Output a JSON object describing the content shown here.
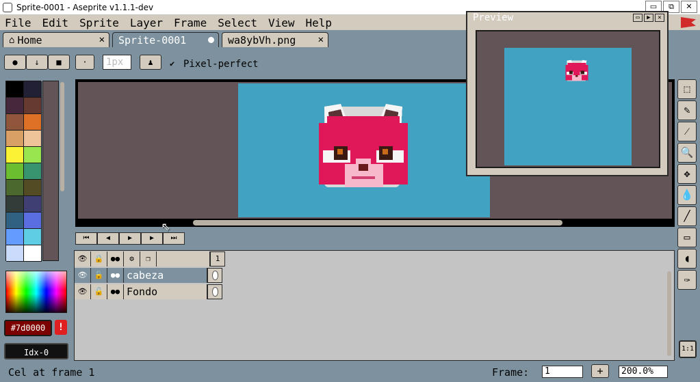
{
  "window": {
    "title": "Sprite-0001 - Aseprite v1.1.1-dev",
    "minimize": "▭",
    "restore": "⧉",
    "close": "✕"
  },
  "menu": [
    "File",
    "Edit",
    "Sprite",
    "Layer",
    "Frame",
    "Select",
    "View",
    "Help"
  ],
  "tabs": [
    {
      "label": "Home",
      "icon": "home-icon",
      "close": "✕"
    },
    {
      "label": "Sprite-0001",
      "active": true
    },
    {
      "label": "wa8ybVh.png",
      "close": "✕"
    }
  ],
  "toolbar": {
    "brush_size": "1px",
    "pixel_perfect_check": "✔",
    "pixel_perfect_label": "Pixel-perfect"
  },
  "palette": {
    "colors": [
      "#000000",
      "#222034",
      "#45283c",
      "#663931",
      "#8f563b",
      "#df7126",
      "#d9a066",
      "#eec39a",
      "#fbf236",
      "#99e550",
      "#6abe30",
      "#37946e",
      "#4b692f",
      "#524b24",
      "#323c39",
      "#3f3f74",
      "#306082",
      "#5b6ee1",
      "#639bff",
      "#5fcde4",
      "#cbdbfc",
      "#ffffff"
    ],
    "fg_hex": "#7d0000",
    "warning": "!",
    "index": "Idx-0"
  },
  "animation_controls": [
    "⏮",
    "◀",
    "▶",
    "▶",
    "⏭"
  ],
  "timeline": {
    "header_icons": [
      "eye-icon",
      "lock-icon",
      "continuous-icon",
      "gear-icon",
      "onion-skin-icon"
    ],
    "header_glyphs": [
      "👁",
      "🔒",
      "●●",
      "⚙",
      "❐"
    ],
    "frame_number": "1",
    "layers": [
      {
        "name": "cabeza",
        "selected": true
      },
      {
        "name": "Fondo",
        "selected": false
      }
    ],
    "layer_glyphs": [
      "👁",
      "🔓",
      "●●"
    ]
  },
  "preview": {
    "title": "Preview",
    "buttons": [
      "▭",
      "▶",
      "✕"
    ]
  },
  "tools": [
    {
      "name": "rectangular-marquee-icon",
      "glyph": "⬚"
    },
    {
      "name": "pencil-icon",
      "glyph": "✎"
    },
    {
      "name": "eyedropper-icon",
      "glyph": "⁄"
    },
    {
      "name": "zoom-icon",
      "glyph": "🔍"
    },
    {
      "name": "move-icon",
      "glyph": "✥"
    },
    {
      "name": "paint-bucket-icon",
      "glyph": "💧"
    },
    {
      "name": "line-icon",
      "glyph": "╱"
    },
    {
      "name": "rectangle-icon",
      "glyph": "▭"
    },
    {
      "name": "contour-icon",
      "glyph": "◖"
    },
    {
      "name": "spray-icon",
      "glyph": "✑"
    }
  ],
  "zoom_reset": "1:1",
  "status": {
    "text": "Cel at frame 1",
    "frame_label": "Frame:",
    "frame_value": "1",
    "add_frame": "+",
    "zoom": "200.0%"
  }
}
